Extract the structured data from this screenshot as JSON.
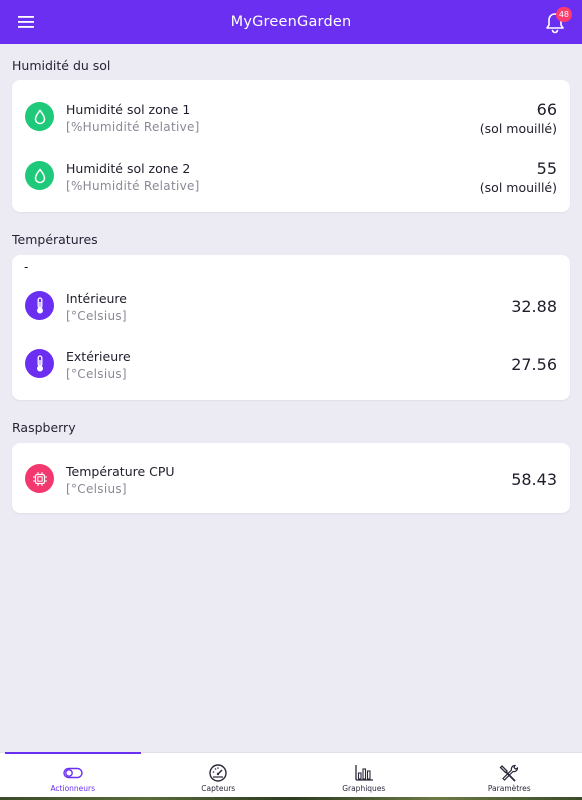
{
  "app": {
    "title": "MyGreenGarden",
    "notification_count": "48",
    "accent_color": "#6a2ff0"
  },
  "sections": {
    "humidity": {
      "title": "Humidité du sol",
      "rows": [
        {
          "name": "Humidité sol zone 1",
          "unit": "[%Humidité Relative]",
          "value": "66",
          "status": "(sol mouillé)",
          "icon": "water-drop-icon",
          "icon_color": "#1fc97a"
        },
        {
          "name": "Humidité sol zone 2",
          "unit": "[%Humidité Relative]",
          "value": "55",
          "status": "(sol mouillé)",
          "icon": "water-drop-icon",
          "icon_color": "#1fc97a"
        }
      ]
    },
    "temperatures": {
      "title": "Températures",
      "dash": "-",
      "rows": [
        {
          "name": "Intérieure",
          "unit": "[°Celsius]",
          "value": "32.88",
          "icon": "thermometer-icon",
          "icon_color": "#6a2ff0"
        },
        {
          "name": "Extérieure",
          "unit": "[°Celsius]",
          "value": "27.56",
          "icon": "thermometer-icon",
          "icon_color": "#6a2ff0"
        }
      ]
    },
    "raspberry": {
      "title": "Raspberry",
      "rows": [
        {
          "name": "Température CPU",
          "unit": "[°Celsius]",
          "value": "58.43",
          "icon": "cpu-chip-icon",
          "icon_color": "#f2386e"
        }
      ]
    }
  },
  "nav": [
    {
      "label": "Actionneurs",
      "icon": "toggle-icon",
      "active": true
    },
    {
      "label": "Capteurs",
      "icon": "gauge-icon",
      "active": false
    },
    {
      "label": "Graphiques",
      "icon": "bar-chart-icon",
      "active": false
    },
    {
      "label": "Paramètres",
      "icon": "tools-icon",
      "active": false
    }
  ]
}
